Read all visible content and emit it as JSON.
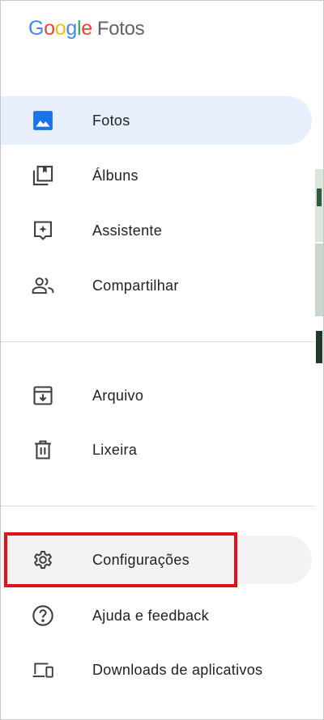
{
  "app": {
    "logo_letters": [
      {
        "ch": "G",
        "color": "#4285f4"
      },
      {
        "ch": "o",
        "color": "#ea4335"
      },
      {
        "ch": "o",
        "color": "#fbbc05"
      },
      {
        "ch": "g",
        "color": "#4285f4"
      },
      {
        "ch": "l",
        "color": "#34a853"
      },
      {
        "ch": "e",
        "color": "#ea4335"
      }
    ],
    "product": "Fotos"
  },
  "nav": {
    "primary": [
      {
        "label": "Fotos",
        "icon": "photo-icon",
        "active": true
      },
      {
        "label": "Álbuns",
        "icon": "albums-icon"
      },
      {
        "label": "Assistente",
        "icon": "assistant-icon"
      },
      {
        "label": "Compartilhar",
        "icon": "sharing-icon"
      }
    ],
    "secondary": [
      {
        "label": "Arquivo",
        "icon": "archive-icon"
      },
      {
        "label": "Lixeira",
        "icon": "trash-icon"
      }
    ],
    "tertiary": [
      {
        "label": "Configurações",
        "icon": "gear-icon",
        "highlighted": true
      },
      {
        "label": "Ajuda e feedback",
        "icon": "help-icon"
      },
      {
        "label": "Downloads de aplicativos",
        "icon": "devices-icon"
      }
    ]
  },
  "colors": {
    "active_bg": "#e8f0fe",
    "active_icon": "#1a73e8",
    "icon": "#5f6368",
    "highlight_border": "#e3101b"
  }
}
